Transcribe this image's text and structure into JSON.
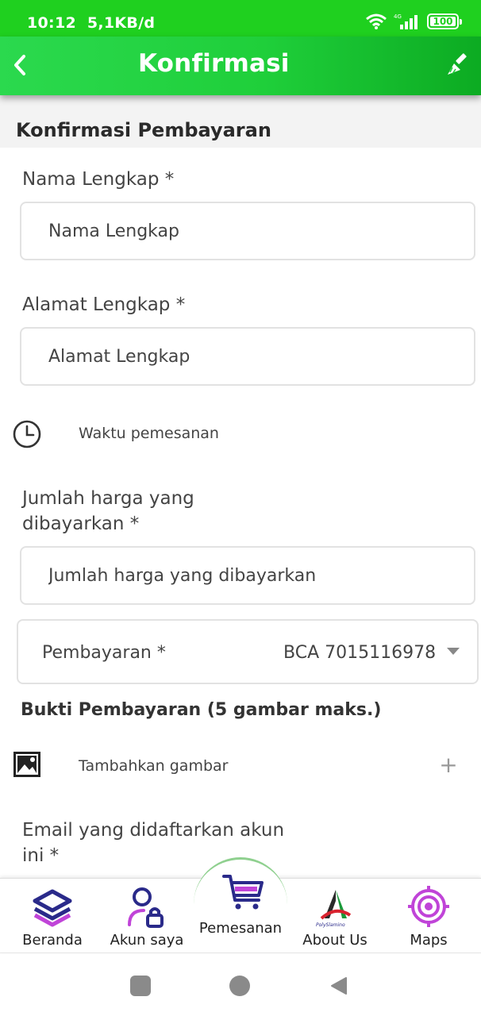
{
  "status_bar": {
    "time": "10:12",
    "speed": "5,1KB/d",
    "network": "4G",
    "battery": "100"
  },
  "app_bar": {
    "title": "Konfirmasi"
  },
  "section": {
    "title": "Konfirmasi Pembayaran"
  },
  "form": {
    "nama": {
      "label": "Nama Lengkap *",
      "placeholder": "Nama Lengkap"
    },
    "alamat": {
      "label": "Alamat Lengkap *",
      "placeholder": "Alamat Lengkap"
    },
    "waktu": {
      "label": "Waktu pemesanan"
    },
    "jumlah": {
      "label_line1": "Jumlah harga yang",
      "label_line2": "dibayarkan *",
      "placeholder": "Jumlah harga yang dibayarkan"
    },
    "pembayaran": {
      "label": "Pembayaran *",
      "value": "BCA 7015116978"
    },
    "bukti": {
      "title": "Bukti Pembayaran (5 gambar maks.)",
      "add_label": "Tambahkan gambar",
      "add_symbol": "+"
    },
    "email": {
      "label_line1": "Email yang didaftarkan akun",
      "label_line2": "ini *"
    }
  },
  "bottom_nav": {
    "items": [
      {
        "label": "Beranda"
      },
      {
        "label": "Akun saya"
      },
      {
        "label": "Pemesanan"
      },
      {
        "label": "About Us",
        "logo_text": "PolySlamino"
      },
      {
        "label": "Maps"
      }
    ]
  },
  "colors": {
    "green": "#1fd01f",
    "purple": "#b040e0",
    "navy": "#2a2a8a"
  }
}
